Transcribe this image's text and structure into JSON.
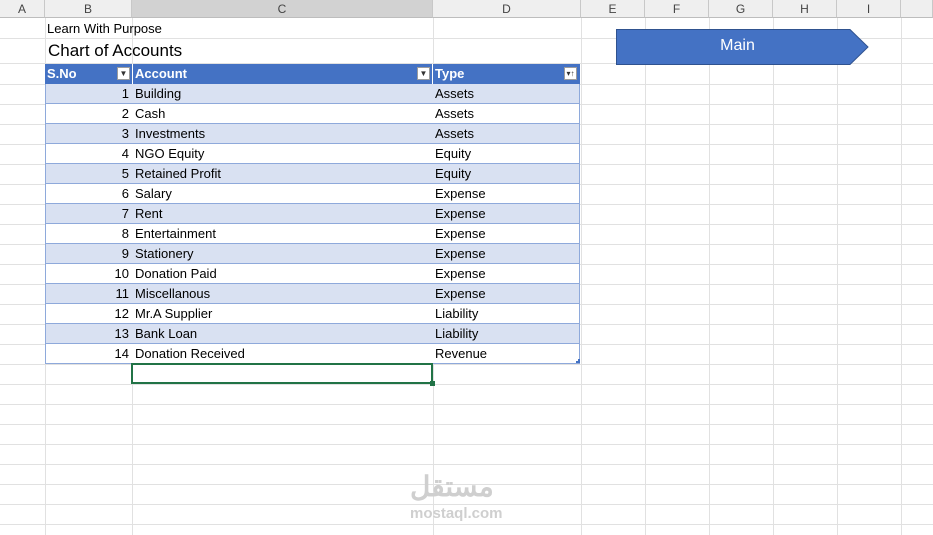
{
  "columns": [
    "A",
    "B",
    "C",
    "D",
    "E",
    "F",
    "G",
    "H",
    "I"
  ],
  "title_line": "Learn With Purpose",
  "sheet_title": "Chart of Accounts",
  "table": {
    "headers": [
      "S.No",
      "Account",
      "Type"
    ],
    "rows": [
      {
        "sno": "1",
        "account": "Building",
        "type": "Assets"
      },
      {
        "sno": "2",
        "account": "Cash",
        "type": "Assets"
      },
      {
        "sno": "3",
        "account": "Investments",
        "type": "Assets"
      },
      {
        "sno": "4",
        "account": "NGO Equity",
        "type": "Equity"
      },
      {
        "sno": "5",
        "account": "Retained Profit",
        "type": "Equity"
      },
      {
        "sno": "6",
        "account": "Salary",
        "type": "Expense"
      },
      {
        "sno": "7",
        "account": "Rent",
        "type": "Expense"
      },
      {
        "sno": "8",
        "account": "Entertainment",
        "type": "Expense"
      },
      {
        "sno": "9",
        "account": "Stationery",
        "type": "Expense"
      },
      {
        "sno": "10",
        "account": "Donation Paid",
        "type": "Expense"
      },
      {
        "sno": "11",
        "account": "Miscellanous",
        "type": "Expense"
      },
      {
        "sno": "12",
        "account": "Mr.A Supplier",
        "type": "Liability"
      },
      {
        "sno": "13",
        "account": "Bank Loan",
        "type": "Liability"
      },
      {
        "sno": "14",
        "account": "Donation Received",
        "type": "Revenue"
      }
    ]
  },
  "main_button": {
    "label": "Main",
    "color": "#4472c4"
  },
  "watermark": {
    "arabic": "مستقل",
    "latin": "mostaql.com"
  },
  "colors": {
    "header_fill": "#4472c4",
    "band_fill": "#d9e1f2",
    "band_border": "#8ea9db",
    "selection": "#217346"
  }
}
